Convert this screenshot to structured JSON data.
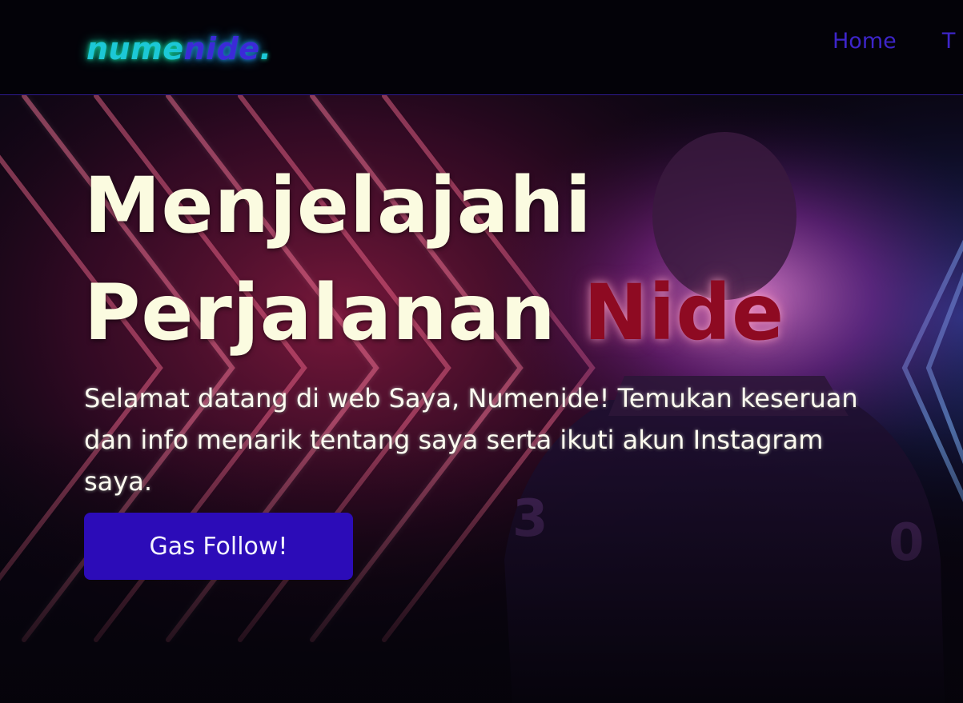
{
  "brand": {
    "logo_part1": "nume",
    "logo_part2": "nide",
    "logo_part3": "."
  },
  "nav": {
    "items": [
      {
        "label": "Home"
      },
      {
        "label": "T"
      }
    ]
  },
  "hero": {
    "title_line1": "Menjelajahi",
    "title_line2_main": "Perjalanan",
    "title_line2_accent": "Nide",
    "subtitle": "Selamat datang di web Saya, Numenide! Temukan keseruan dan info menarik tentang saya serta ikuti akun Instagram saya.",
    "cta_label": "Gas Follow!",
    "jersey_number_left": "3",
    "jersey_number_right": "0"
  },
  "colors": {
    "background": "#06040b",
    "navbar_bg": "#030208",
    "navbar_border": "#2e1a8f",
    "logo_cyan": "#1cc8d6",
    "logo_violet": "#3b2ad8",
    "nav_link": "#3d25c9",
    "headline": "#fbfbe0",
    "headline_accent": "#8e0a22",
    "cta_bg": "#2c0cb8",
    "neon_red": "#ff5a86",
    "neon_blue": "#5aa8ff"
  }
}
